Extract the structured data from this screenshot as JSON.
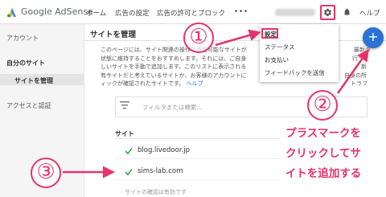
{
  "header": {
    "brand": "Google AdSense",
    "nav": [
      "ホーム",
      "広告の設定",
      "広告の許可とブロック",
      "•••"
    ],
    "help": "ヘルプ"
  },
  "sidebar": {
    "items": [
      {
        "label": "アカウント"
      },
      {
        "label": "自分のサイト"
      },
      {
        "label": "サイトを管理"
      },
      {
        "label": "アクセスと認証"
      }
    ]
  },
  "main": {
    "title": "サイトを管理",
    "desc_lines": [
      "このページには、サイト関連の操作で使用可能なサイトが",
      "状態に維持することをおすすめします。それには、ご自身",
      "しいサイトを手動で追加します。このリストに表示される",
      "有サイトだと考えているサイトか、お客様のアカウントに",
      "ィックが確認されたサイトです。"
    ],
    "desc_right_fragments": [
      "最新の",
      "行うた",
      "、新",
      "自身の所",
      "トラフ"
    ],
    "help_link": "ヘルプ",
    "filter_placeholder": "フィルタまたは検索...",
    "sites_title": "サイト",
    "sites": [
      {
        "name": "blog.livedoor.jp"
      },
      {
        "name": "sims-lab.com"
      }
    ],
    "footer_text": "サイトの確認は有効です"
  },
  "dropdown": {
    "items": [
      "設定",
      "ステータス",
      "お支払い",
      "フィードバックを送信"
    ]
  },
  "annotations": {
    "circle1": "①",
    "circle2": "②",
    "circle3": "③",
    "text_lines": [
      "プラスマークを",
      "クリックしてサ",
      "イトを追加する"
    ]
  },
  "colors": {
    "accent_pink": "#e8336a",
    "fab_blue": "#2a72d4",
    "link_blue": "#1a73e8",
    "check_green": "#34a853"
  },
  "icons": {
    "logo": "adsense-logo-icon",
    "gear": "gear-icon",
    "bell": "bell-icon",
    "filter": "filter-icon",
    "check": "check-icon",
    "plus": "plus-icon"
  }
}
